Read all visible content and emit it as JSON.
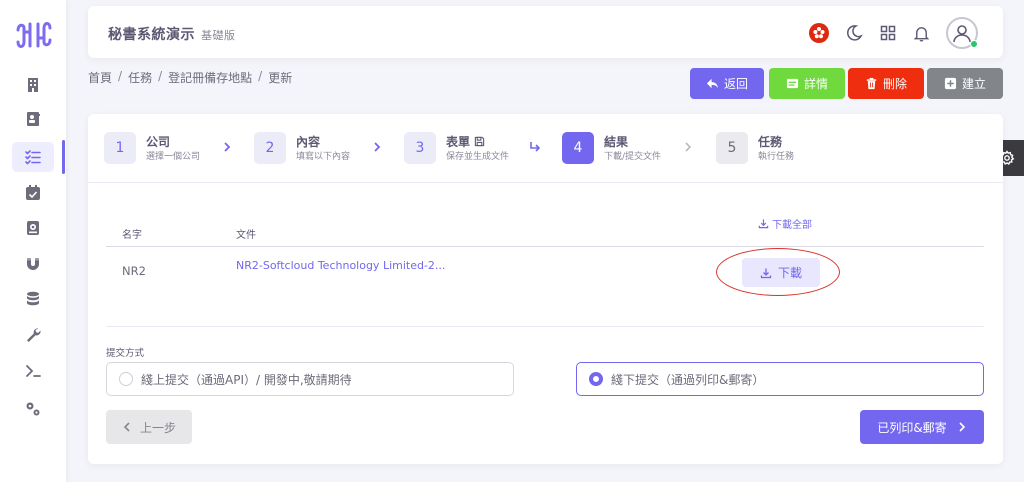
{
  "header": {
    "title": "秘書系統演示",
    "edition": "基礎版"
  },
  "breadcrumb": [
    {
      "label": "首頁"
    },
    {
      "label": "任務"
    },
    {
      "label": "登記冊備存地點"
    },
    {
      "label": "更新"
    }
  ],
  "breadcrumb_separator": "/",
  "actions": {
    "back": "返回",
    "details": "詳情",
    "delete": "刪除",
    "create": "建立"
  },
  "steps": [
    {
      "number": "1",
      "title": "公司",
      "subtitle": "選擇一個公司"
    },
    {
      "number": "2",
      "title": "內容",
      "subtitle": "填寫以下內容"
    },
    {
      "number": "3",
      "title": "表單",
      "subtitle": "保存並生成文件"
    },
    {
      "number": "4",
      "title": "結果",
      "subtitle": "下載/提交文件"
    },
    {
      "number": "5",
      "title": "任務",
      "subtitle": "執行任務"
    }
  ],
  "table": {
    "download_all": "下載全部",
    "columns": {
      "name": "名字",
      "file": "文件"
    },
    "rows": [
      {
        "name": "NR2",
        "file": "NR2-Softcloud Technology Limited-2...",
        "action": "下載"
      }
    ]
  },
  "submission": {
    "label": "提交方式",
    "options": [
      {
        "label": "綫上提交（通過API）/ 開發中,敬請期待",
        "selected": false
      },
      {
        "label": "綫下提交（通過列印&郵寄）",
        "selected": true
      }
    ]
  },
  "nav": {
    "prev": "上一步",
    "next": "已列印&郵寄"
  },
  "colors": {
    "primary": "#7367f0",
    "success": "#6fd93e",
    "danger": "#ee2e0e",
    "secondary": "#82868b"
  }
}
